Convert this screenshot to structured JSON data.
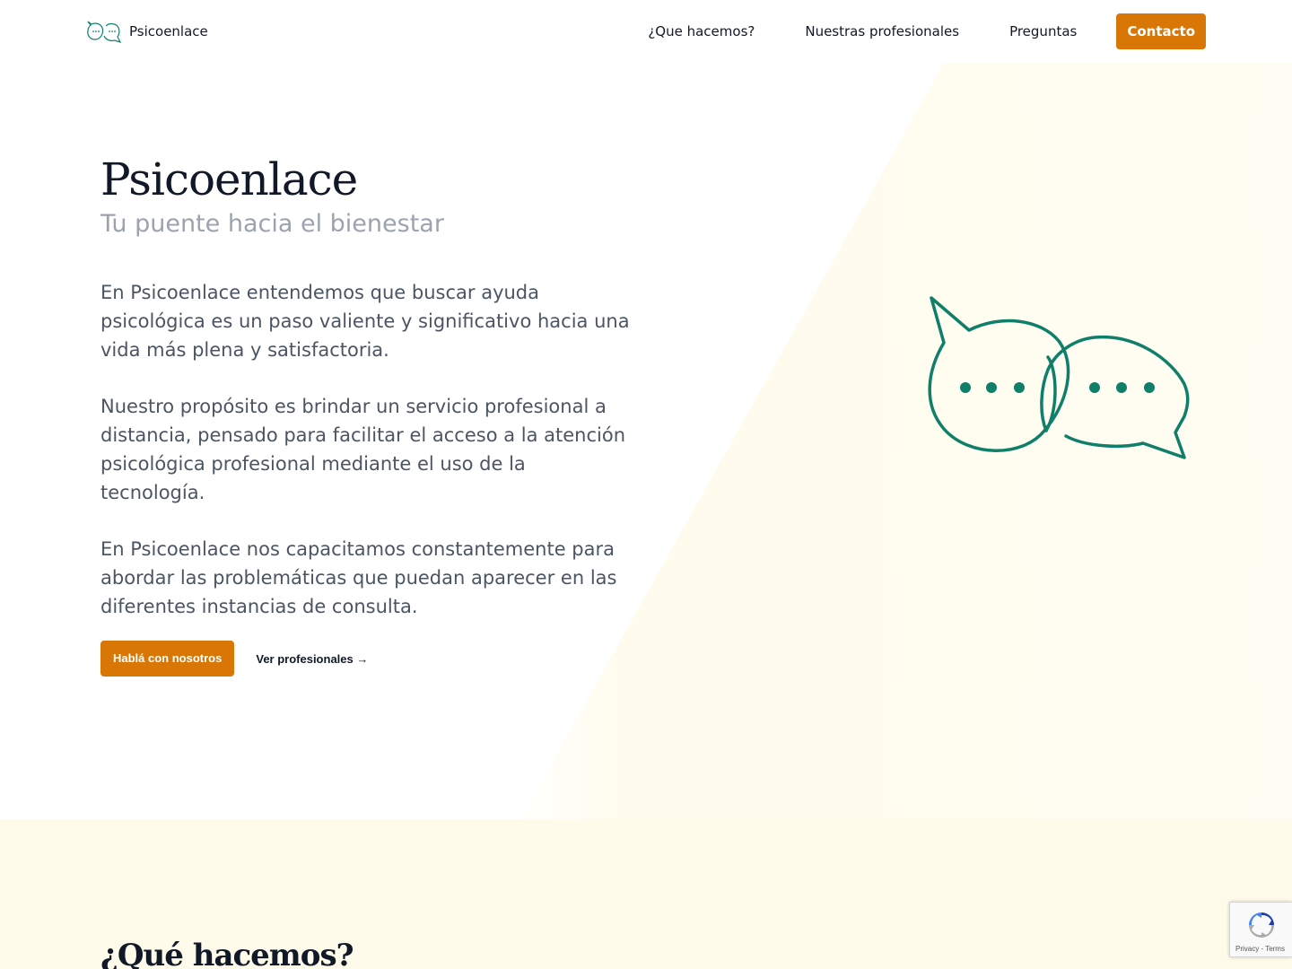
{
  "header": {
    "brand_name": "Psicoenlace",
    "nav": {
      "item1": "¿Que hacemos?",
      "item2": "Nuestras profesionales",
      "item3": "Preguntas",
      "contact": "Contacto"
    }
  },
  "hero": {
    "title": "Psicoenlace",
    "subtitle": "Tu puente hacia el bienestar",
    "paragraphs": {
      "p1": "En Psicoenlace entendemos que buscar ayuda psicológica es un paso valiente y significativo hacia una vida más plena y satisfactoria.",
      "p2": "Nuestro propósito es brindar un servicio profesional a distancia, pensado para facilitar el acceso a la atención psicológica profesional mediante el uso de la tecnología.",
      "p3": "En Psicoenlace nos capacitamos constantemente para abordar las problemáticas que puedan aparecer en las diferentes instancias de consulta."
    },
    "cta_primary": "Hablá con nosotros",
    "cta_secondary": "Ver profesionales →"
  },
  "section": {
    "title": "¿Qué hacemos?"
  },
  "recaptcha": {
    "links": "Privacy - Terms"
  },
  "colors": {
    "accent": "#d97706",
    "teal": "#0f7f6a",
    "cream": "#fffbeb"
  },
  "icons": {
    "brand_logo": "speech-bubbles-icon",
    "hero_illustration": "speech-bubbles-icon",
    "recaptcha": "recaptcha-icon"
  }
}
